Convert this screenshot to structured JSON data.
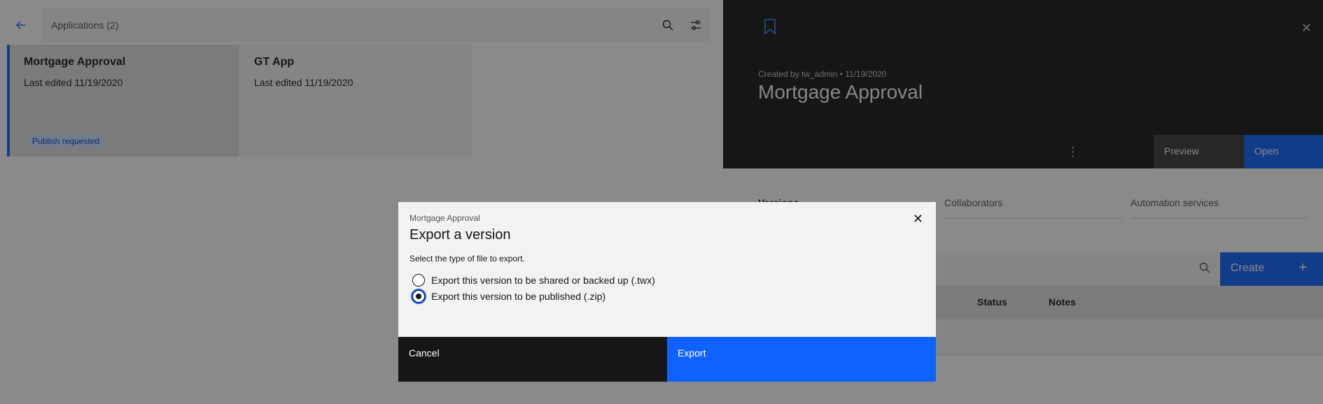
{
  "left": {
    "search_title": "Applications (2)",
    "cards": [
      {
        "title": "Mortgage Approval",
        "subtitle": "Last edited 11/19/2020",
        "tag": "Publish requested"
      },
      {
        "title": "GT App",
        "subtitle": "Last edited 11/19/2020"
      }
    ]
  },
  "right": {
    "created": "Created by tw_admin • 11/19/2020",
    "title": "Mortgage Approval",
    "preview_label": "Preview",
    "open_label": "Open",
    "tabs": [
      {
        "label": "Versions"
      },
      {
        "label": "Collaborators"
      },
      {
        "label": "Automation services"
      }
    ],
    "create_label": "Create",
    "table_headers": {
      "status": "Status",
      "notes": "Notes"
    }
  },
  "modal": {
    "label": "Mortgage Approval",
    "title": "Export a version",
    "description": "Select the type of file to export.",
    "options": [
      {
        "label": "Export this version to be shared or backed up (.twx)"
      },
      {
        "label": "Export this version to be published (.zip)"
      }
    ],
    "cancel_label": "Cancel",
    "export_label": "Export"
  },
  "colors": {
    "accent": "#0f62fe",
    "dark": "#161616"
  }
}
